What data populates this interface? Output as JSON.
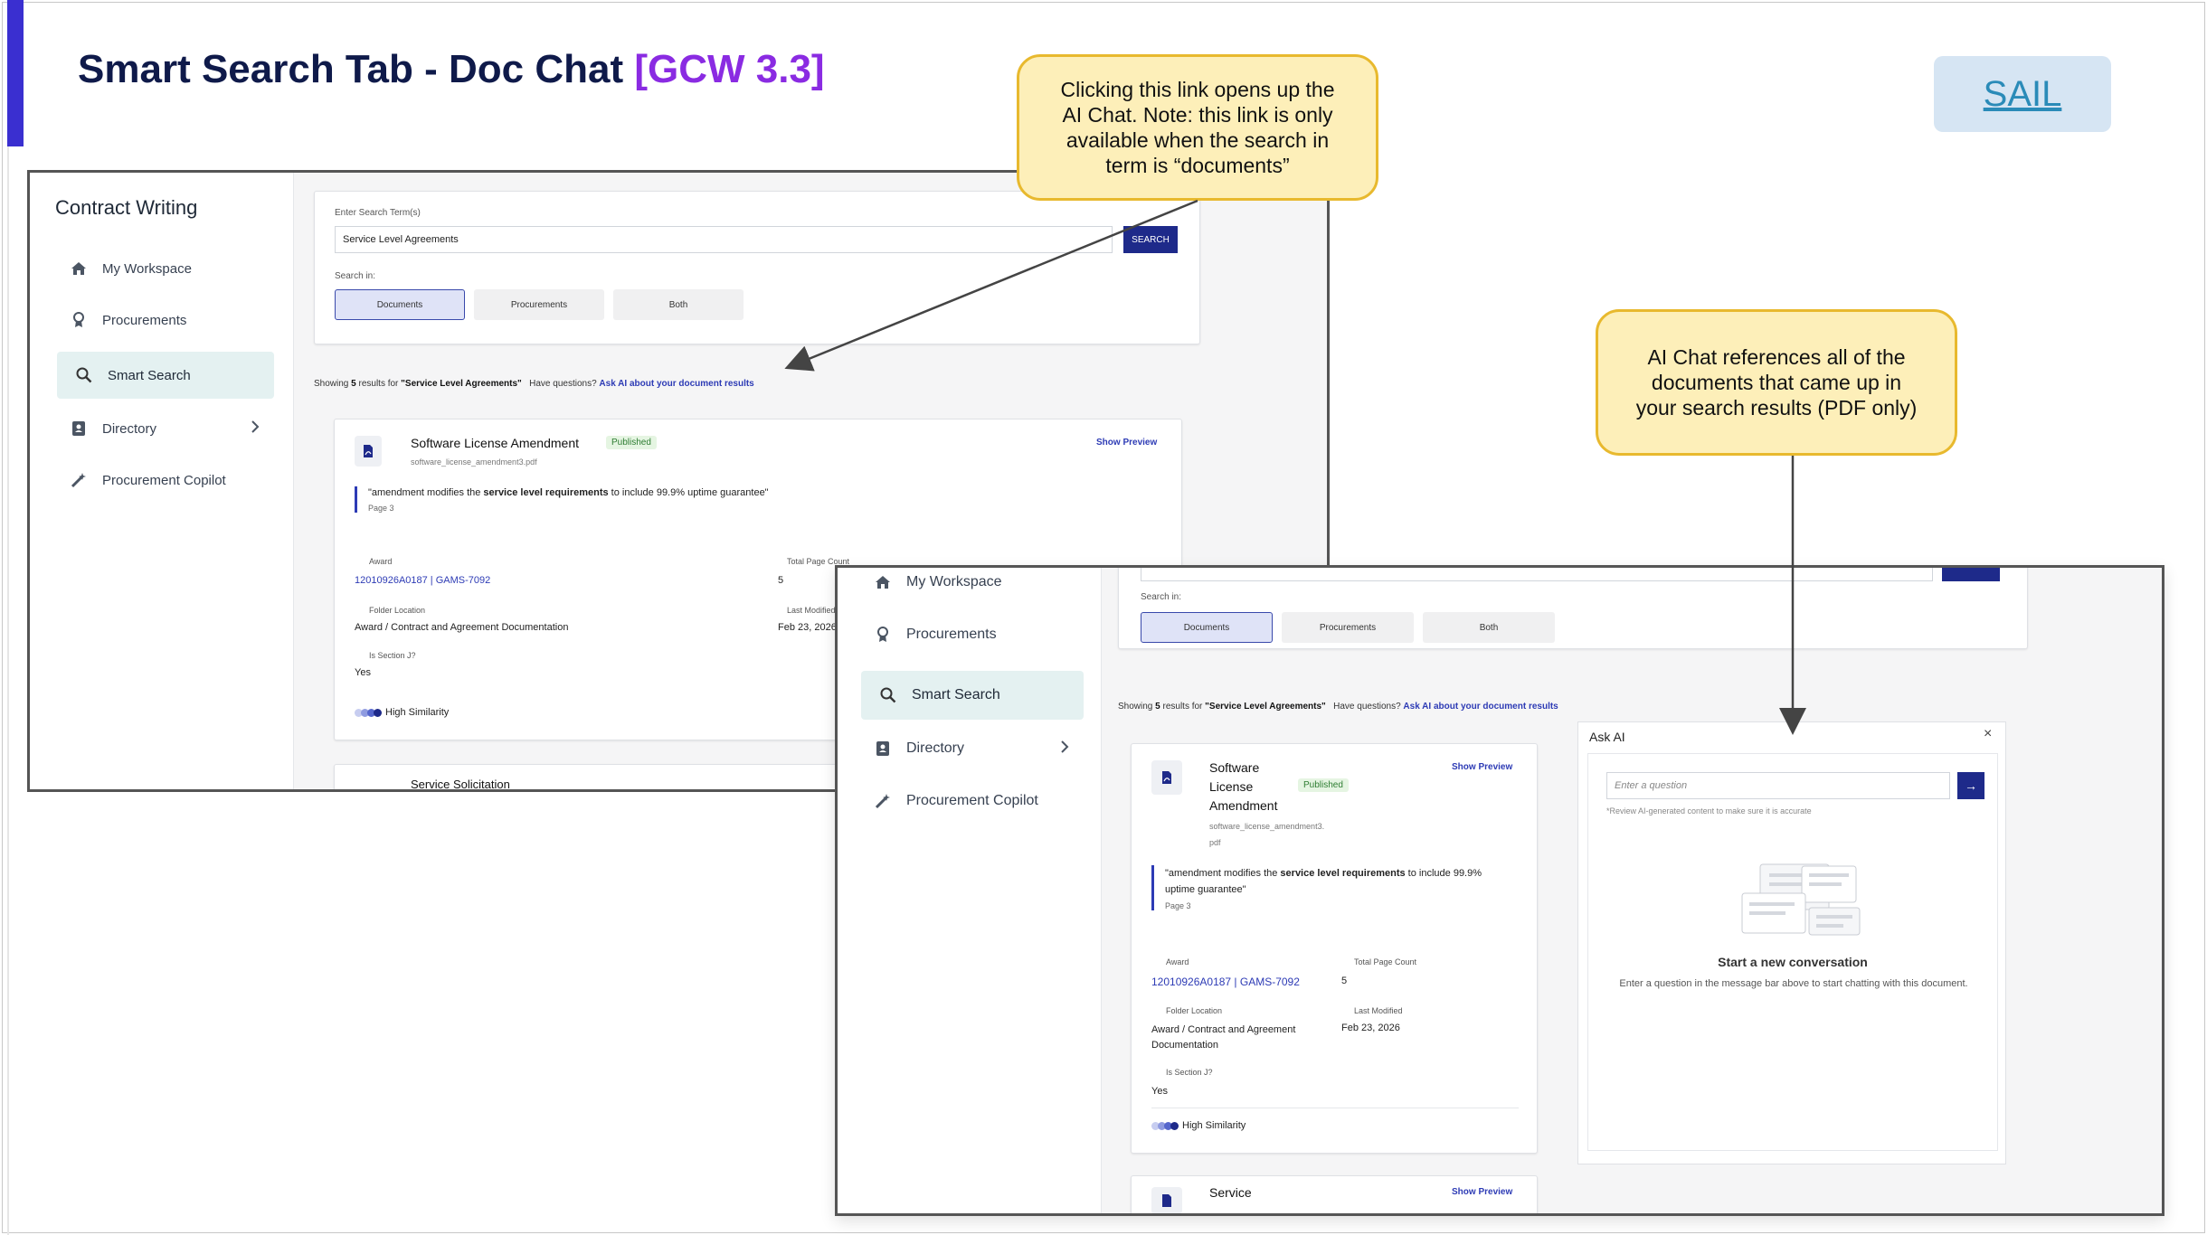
{
  "slide": {
    "title": "Smart Search Tab - Doc Chat",
    "version": "[GCW 3.3]",
    "sail_link": "SAIL"
  },
  "callouts": {
    "top": "Clicking this link opens up the AI Chat. Note: this link is only available when the search in term is “documents”",
    "right": "AI Chat references all of the documents that came up in your search results (PDF only)"
  },
  "app": {
    "sidebar_title": "Contract Writing",
    "nav": [
      {
        "label": "My Workspace",
        "icon": "home-icon"
      },
      {
        "label": "Procurements",
        "icon": "award-icon"
      },
      {
        "label": "Smart Search",
        "icon": "search-icon",
        "active": true
      },
      {
        "label": "Directory",
        "icon": "contact-book-icon",
        "has_chevron": true
      },
      {
        "label": "Procurement Copilot",
        "icon": "magic-wand-icon"
      }
    ],
    "search": {
      "label": "Enter Search Term(s)",
      "value": "Service Level Agreements",
      "button": "SEARCH",
      "search_in_label": "Search in:",
      "options": [
        "Documents",
        "Procurements",
        "Both"
      ],
      "selected": "Documents"
    },
    "results": {
      "showing_prefix": "Showing",
      "count": "5",
      "showing_mid": "results for",
      "query": "\"Service Level Agreements\"",
      "question": "Have questions?",
      "ask_link": "Ask AI about your document results"
    },
    "result_card": {
      "title": "Software License Amendment",
      "status": "Published",
      "filename": "software_license_amendment3.pdf",
      "show_preview": "Show Preview",
      "quote_before": "\"amendment modifies the ",
      "quote_bold": "service level requirements",
      "quote_after": " to include 99.9% uptime guarantee\"",
      "page": "Page 3",
      "award_label": "Award",
      "award_value": "12010926A0187 | GAMS-7092",
      "total_pages_label": "Total Page Count",
      "total_pages_value": "5",
      "folder_label": "Folder Location",
      "folder_value": "Award / Contract and Agreement Documentation",
      "modified_label": "Last Modified",
      "modified_value": "Feb 23, 2026",
      "section_label": "Is Section J?",
      "section_value": "Yes",
      "similarity": "High Similarity"
    },
    "next_card_title": "Service",
    "next_card_partial": "Service Solicitation",
    "ask_ai": {
      "title": "Ask AI",
      "close": "×",
      "placeholder": "Enter a question",
      "send": "→",
      "disclaimer": "*Review AI-generated content to make sure it is accurate",
      "empty_title": "Start a new conversation",
      "empty_desc": "Enter a question in the message bar above to start chatting with this document."
    }
  },
  "colors": {
    "accent_bar": "#3a2fd0",
    "title": "#0f1a4a",
    "version": "#8a2be2",
    "callout_bg": "#fdefb9",
    "callout_border": "#e8b92e",
    "primary_button": "#1e2a8a",
    "link": "#2d3bb5"
  }
}
